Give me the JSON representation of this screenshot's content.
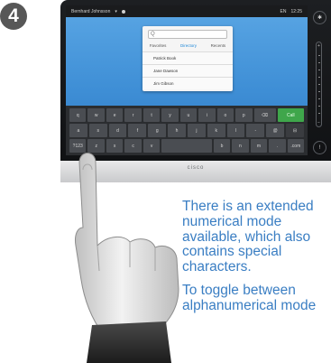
{
  "step": {
    "number": "4"
  },
  "device": {
    "brand": "cisco",
    "statusbar": {
      "user": "Bernhard Johnsson",
      "indicator": "▾",
      "battery": "EN",
      "time": "12:25"
    },
    "popup": {
      "search_placeholder": "Q",
      "tabs": [
        {
          "label": "Favorites",
          "active": false
        },
        {
          "label": "Directory",
          "active": true
        },
        {
          "label": "Recents",
          "active": false
        }
      ],
      "entries": [
        "Patrick Book",
        "Jane Dawson",
        "Jim Gibson"
      ]
    },
    "keyboard": {
      "rows": [
        [
          "q",
          "w",
          "e",
          "r",
          "t",
          "y",
          "u",
          "i",
          "o",
          "p",
          "⌫",
          "Call"
        ],
        [
          "a",
          "s",
          "d",
          "f",
          "g",
          "h",
          "j",
          "k",
          "l",
          "-",
          "@",
          "⊟"
        ],
        [
          "?123",
          "z",
          "x",
          "c",
          "v",
          "",
          "b",
          "n",
          "m",
          ".",
          ".com"
        ]
      ]
    },
    "rail": {
      "top_button": "✱",
      "bottom_button": "!",
      "slider_plus": "+",
      "slider_minus": "−"
    }
  },
  "description": {
    "p1": [
      "There is an extended",
      "numerical mode",
      "available, which also",
      "contains special",
      "characters."
    ],
    "p2": [
      "To toggle between",
      "alphanumerical mode"
    ]
  }
}
